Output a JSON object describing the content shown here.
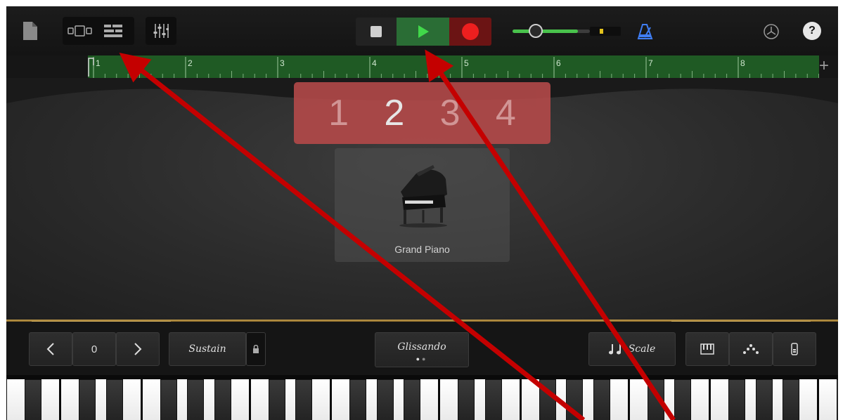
{
  "ruler": {
    "bars": [
      "1",
      "2",
      "3",
      "4",
      "5",
      "6",
      "7",
      "8"
    ]
  },
  "sections": [
    {
      "label": "1",
      "active": false
    },
    {
      "label": "2",
      "active": true
    },
    {
      "label": "3",
      "active": false
    },
    {
      "label": "4",
      "active": false
    }
  ],
  "instrument": {
    "name": "Grand Piano"
  },
  "controls": {
    "octave_value": "0",
    "sustain_label": "Sustain",
    "glissando_label": "Glissando",
    "scale_label": "Scale"
  },
  "colors": {
    "ruler_green": "#1f5a24",
    "play_green": "#2a6d35",
    "record_red": "#e02020",
    "section_red": "#b74a4a",
    "arrow_red": "#c40000"
  },
  "volume_level": 0.3
}
